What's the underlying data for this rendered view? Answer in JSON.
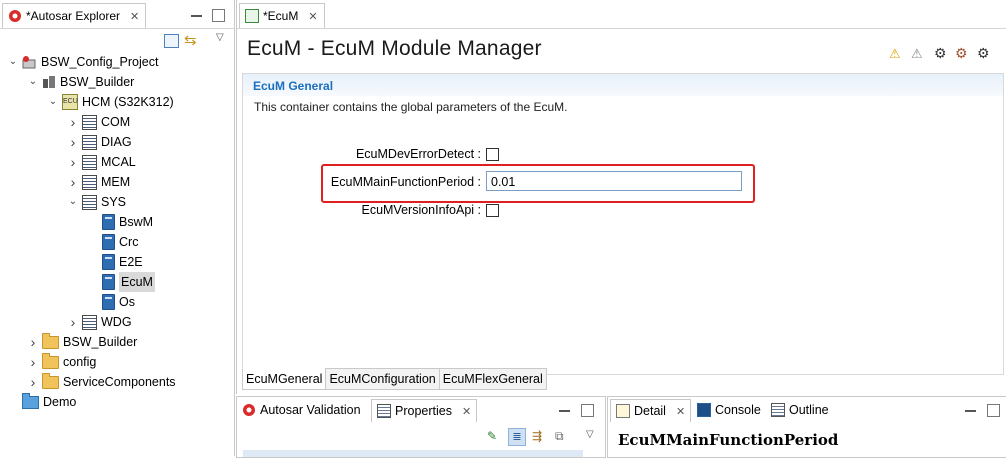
{
  "explorer": {
    "tab_label": "*Autosar Explorer",
    "tree": [
      {
        "label": "BSW_Config_Project",
        "depth": 0,
        "icon": "project-icon",
        "expanded": true
      },
      {
        "label": "BSW_Builder",
        "depth": 1,
        "icon": "builder-icon",
        "expanded": true
      },
      {
        "label": "HCM (S32K312)",
        "depth": 2,
        "icon": "ecu-icon",
        "expanded": true
      },
      {
        "label": "COM",
        "depth": 3,
        "icon": "list-icon",
        "expanded": false
      },
      {
        "label": "DIAG",
        "depth": 3,
        "icon": "list-icon",
        "expanded": false
      },
      {
        "label": "MCAL",
        "depth": 3,
        "icon": "list-icon",
        "expanded": false
      },
      {
        "label": "MEM",
        "depth": 3,
        "icon": "list-icon",
        "expanded": false
      },
      {
        "label": "SYS",
        "depth": 3,
        "icon": "list-icon",
        "expanded": true
      },
      {
        "label": "BswM",
        "depth": 4,
        "icon": "module-icon"
      },
      {
        "label": "Crc",
        "depth": 4,
        "icon": "module-icon"
      },
      {
        "label": "E2E",
        "depth": 4,
        "icon": "module-icon"
      },
      {
        "label": "EcuM",
        "depth": 4,
        "icon": "module-icon",
        "selected": true
      },
      {
        "label": "Os",
        "depth": 4,
        "icon": "module-icon"
      },
      {
        "label": "WDG",
        "depth": 3,
        "icon": "list-icon",
        "expanded": false
      },
      {
        "label": "BSW_Builder",
        "depth": 1,
        "icon": "folder-icon",
        "expanded": false
      },
      {
        "label": "config",
        "depth": 1,
        "icon": "folder-icon",
        "expanded": false
      },
      {
        "label": "ServiceComponents",
        "depth": 1,
        "icon": "folder-icon",
        "expanded": false
      },
      {
        "label": "Demo",
        "depth": 0,
        "icon": "blue-folder-icon"
      }
    ]
  },
  "editor": {
    "tab_label": "*EcuM",
    "title": "EcuM - EcuM Module Manager",
    "section_title": "EcuM General",
    "section_desc": "This container contains the global parameters of the EcuM.",
    "fields": {
      "dev_error_label": "EcuMDevErrorDetect :",
      "main_period_label": "EcuMMainFunctionPeriod :",
      "main_period_value": "0.01",
      "version_info_label": "EcuMVersionInfoApi :"
    },
    "bottom_tabs": [
      "EcuMGeneral",
      "EcuMConfiguration",
      "EcuMFlexGeneral"
    ]
  },
  "panels": {
    "left_tabs": {
      "validation": "Autosar Validation",
      "properties": "Properties"
    },
    "right_tabs": {
      "detail": "Detail",
      "console": "Console",
      "outline": "Outline"
    },
    "detail_name": "EcuMMainFunctionPeriod"
  },
  "colors": {
    "highlight": "#e02020",
    "section_title": "#1a6fbf"
  }
}
